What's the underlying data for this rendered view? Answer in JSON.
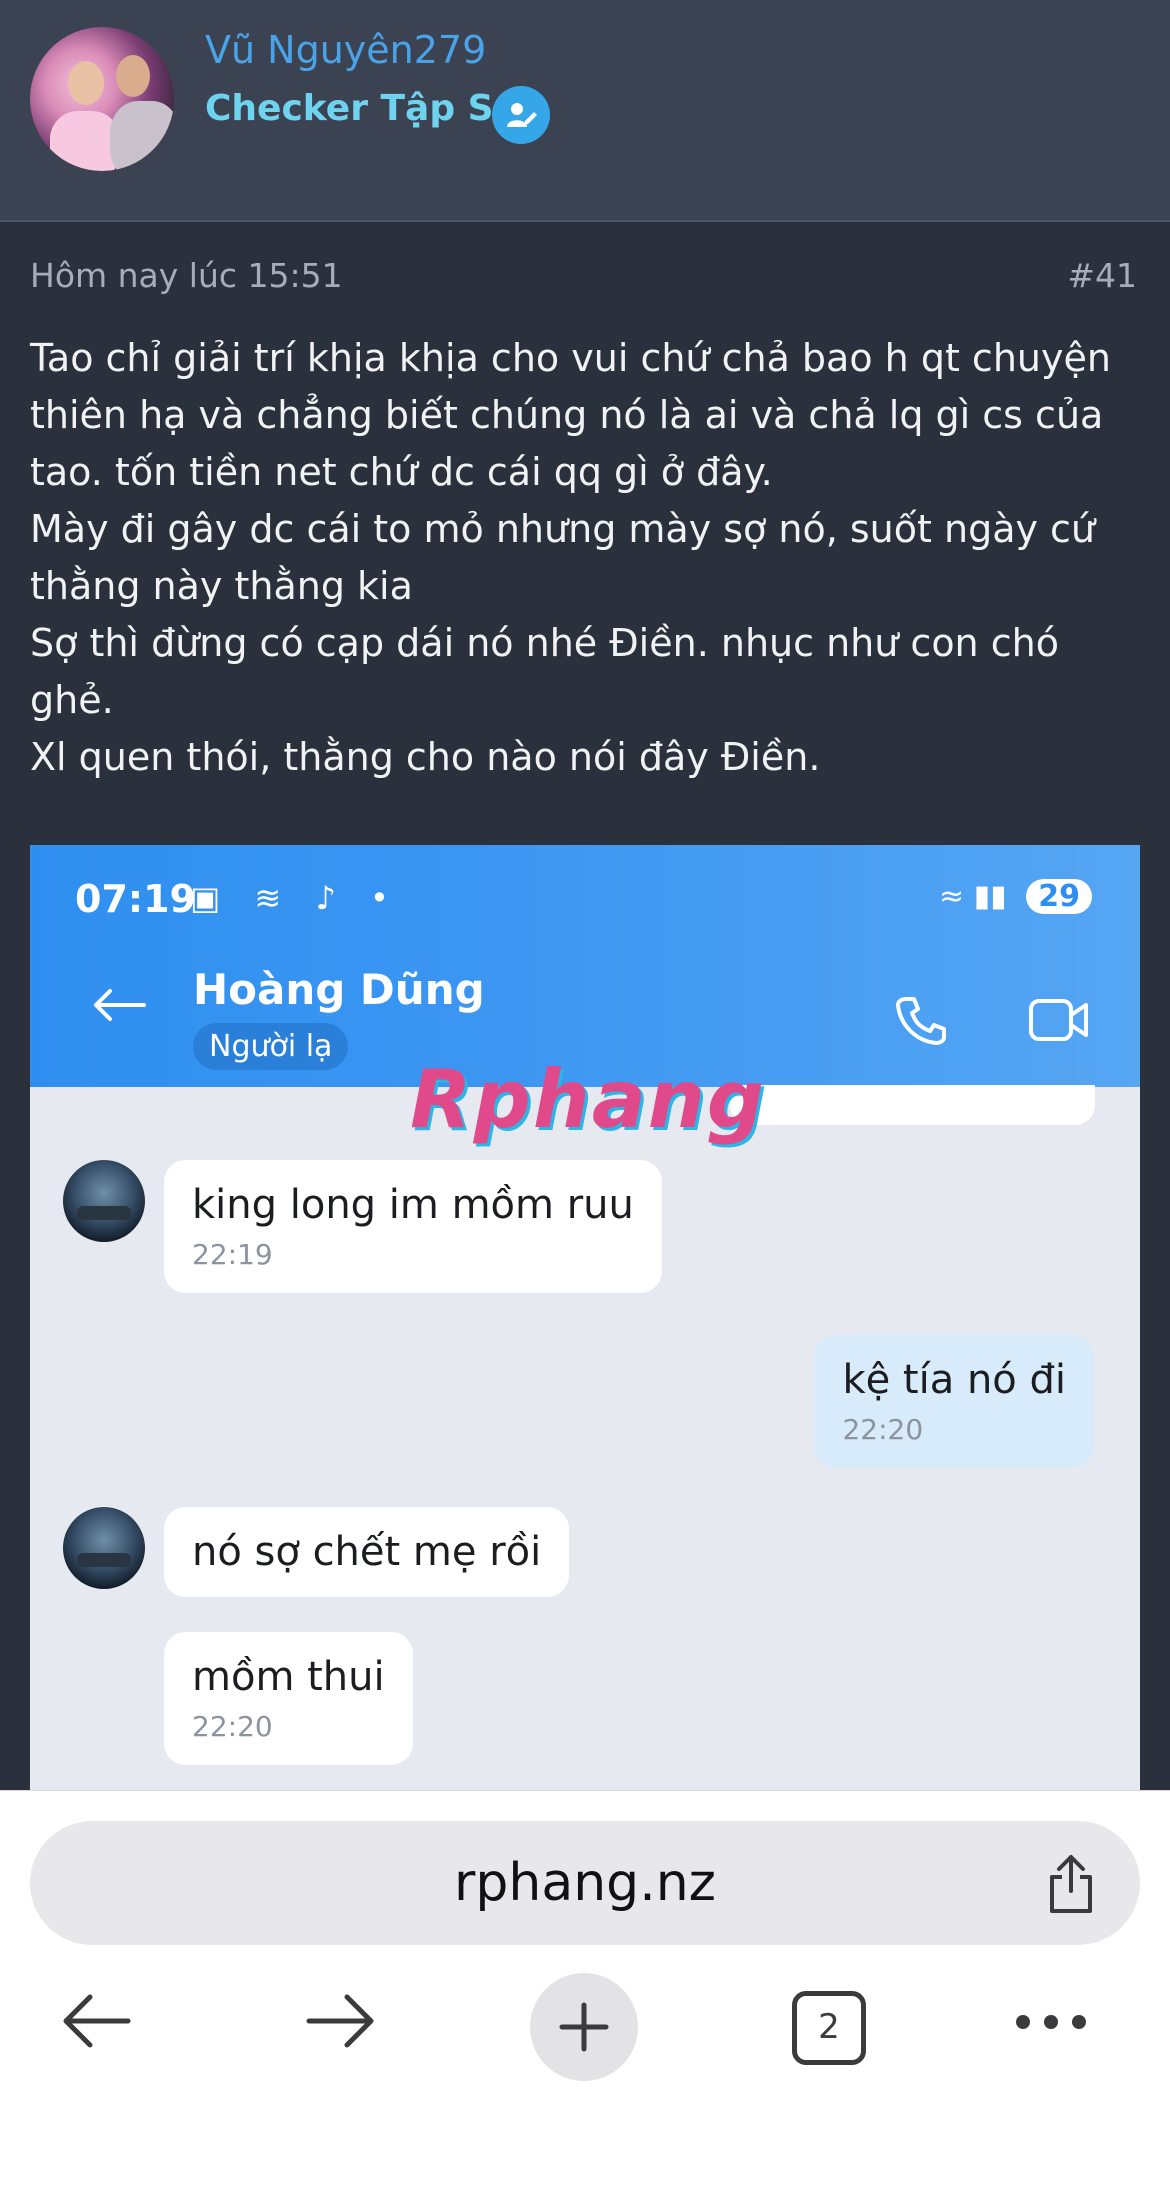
{
  "header": {
    "username": "Vũ Nguyên279",
    "role": "Checker Tập Sự"
  },
  "post": {
    "time": "Hôm nay lúc 15:51",
    "number": "#41",
    "lines": [
      "Tao chỉ giải trí khịa khịa cho vui chứ chả bao h qt chuyện",
      "thiên hạ và chẳng biết chúng nó là ai và chả lq gì cs của",
      "tao. tốn tiền net chứ dc cái qq gì ở đây.",
      "Mày đi gây dc cái to mỏ nhưng mày sợ nó, suốt ngày cứ",
      "thằng này thằng kia",
      "Sợ thì đừng có cạp dái nó nhé Điền. nhục như con chó ghẻ.",
      "",
      "Xl quen thói, thằng cho nào nói đây Điền."
    ]
  },
  "screenshot": {
    "status_time": "07:19",
    "battery": "29",
    "contact_name": "Hoàng Dũng",
    "contact_tag": "Người lạ",
    "watermark": "Rphang",
    "partial_time": "22:19",
    "messages": [
      {
        "side": "them",
        "text": "king long im mồm ruu",
        "time": "22:19"
      },
      {
        "side": "me",
        "text": "kệ tía nó đi",
        "time": "22:20"
      },
      {
        "side": "them",
        "text": "nó sợ chết mẹ rồi",
        "time": ""
      },
      {
        "side": "them",
        "text": "mồm thui",
        "time": "22:20"
      }
    ]
  },
  "browser": {
    "url": "rphang.nz",
    "tab_count": "2"
  },
  "colors": {
    "username": "#4aa3e6",
    "role": "#6ed3ee",
    "badge": "#35a7e8",
    "chat_header": "#2f8ff0",
    "my_bubble": "#d8ebfa"
  }
}
